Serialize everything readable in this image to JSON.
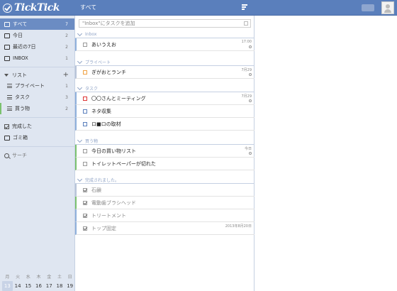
{
  "app": {
    "logo_text": "TickTick",
    "title": "すべて"
  },
  "sidebar": {
    "items": [
      {
        "label": "すべて",
        "count": "7"
      },
      {
        "label": "今日",
        "count": "2"
      },
      {
        "label": "最近の7日",
        "count": "2"
      },
      {
        "label": "INBOX",
        "count": "1"
      }
    ],
    "list_header": "リスト",
    "lists": [
      {
        "label": "プライベート",
        "count": "1"
      },
      {
        "label": "タスク",
        "count": "3"
      },
      {
        "label": "買う物",
        "count": "2"
      }
    ],
    "completed": "完成した",
    "trash": "ゴミ箱",
    "search": "サーチ"
  },
  "calendar": {
    "weekdays": [
      "月",
      "火",
      "水",
      "木",
      "金",
      "土",
      "日"
    ],
    "dates": [
      "13",
      "14",
      "15",
      "16",
      "17",
      "18",
      "19"
    ],
    "today": "13"
  },
  "main": {
    "add_placeholder": "\"Inbox\"にタスクを追加",
    "groups": [
      {
        "name": "Inbox",
        "tasks": [
          {
            "title": "あいうえお",
            "date": "17:00"
          }
        ]
      },
      {
        "name": "プライベート",
        "tasks": [
          {
            "title": "ぎがおとランチ",
            "date": "7月29"
          }
        ]
      },
      {
        "name": "タスク",
        "tasks": [
          {
            "title": "〇〇さんとミーティング",
            "date": "7月29"
          },
          {
            "title": "ネタ収集",
            "date": ""
          },
          {
            "title": "ロ■ロの取材",
            "date": ""
          }
        ]
      },
      {
        "name": "買う物",
        "tasks": [
          {
            "title": "今日の買い物リスト",
            "date": "今日"
          },
          {
            "title": "トイレットペーパーが切れた",
            "date": ""
          }
        ]
      },
      {
        "name": "完成されました。",
        "tasks": [
          {
            "title": "石鹸",
            "date": ""
          },
          {
            "title": "電動歯ブラシヘッド",
            "date": ""
          },
          {
            "title": "トリートメント",
            "date": ""
          },
          {
            "title": "トップ固定",
            "date": "2013年8月20日"
          }
        ]
      }
    ]
  }
}
